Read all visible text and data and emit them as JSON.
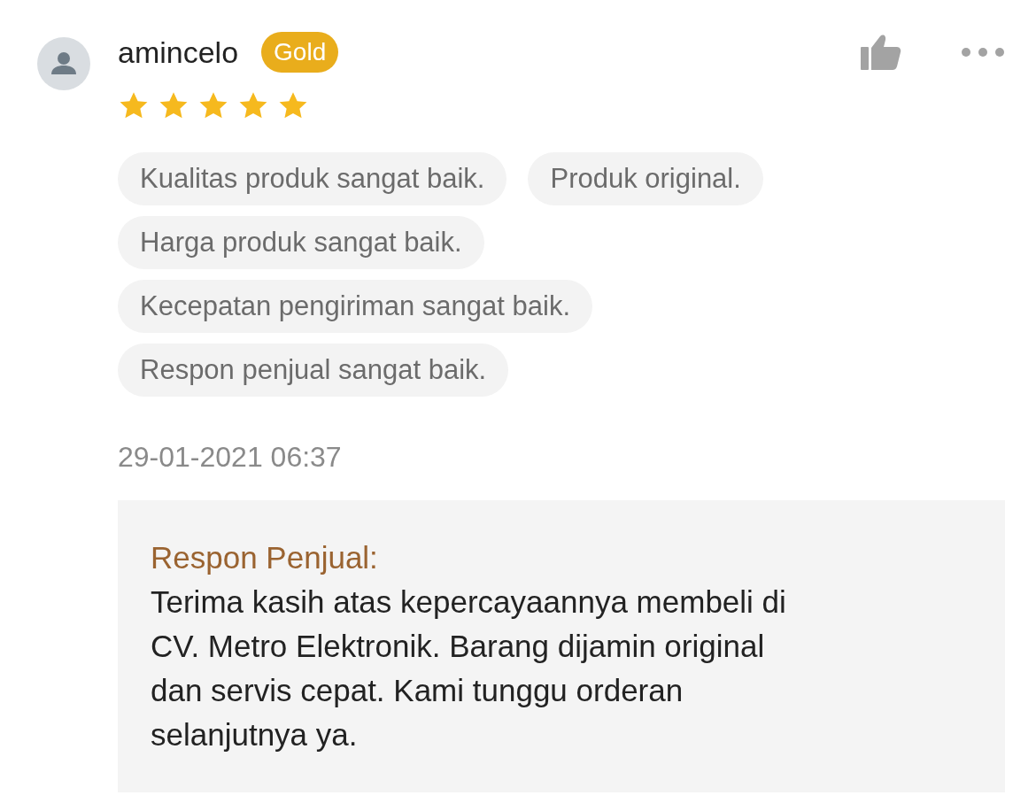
{
  "review": {
    "username": "amincelo",
    "badge": "Gold",
    "stars": 5,
    "tags": [
      "Kualitas produk sangat baik.",
      "Produk original.",
      "Harga produk sangat baik.",
      "Kecepatan pengiriman sangat baik.",
      "Respon penjual sangat baik."
    ],
    "timestamp": "29-01-2021 06:37",
    "seller_response": {
      "title": "Respon Penjual:",
      "text": "Terima kasih atas kepercayaannya membeli di CV. Metro Elektronik. Barang dijamin original dan servis cepat. Kami tunggu orderan selanjutnya ya."
    }
  }
}
